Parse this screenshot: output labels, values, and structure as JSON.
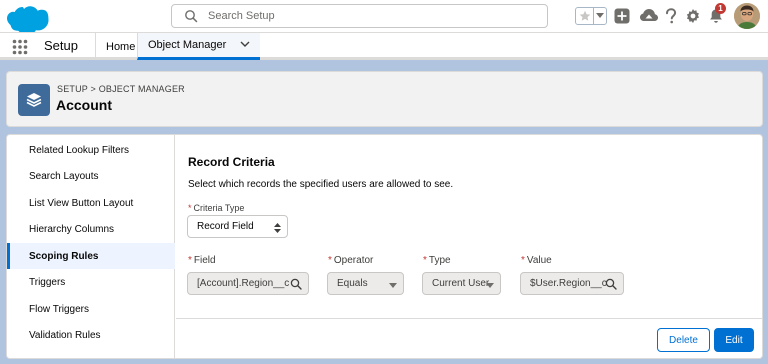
{
  "global_header": {
    "search": {
      "placeholder": "Search Setup",
      "value": ""
    },
    "notification_count": "1",
    "icons": [
      "favorites-star-icon",
      "add-icon",
      "trailhead-icon",
      "help-icon",
      "gear-icon",
      "bell-icon"
    ]
  },
  "context_bar": {
    "app_name": "Setup",
    "tabs": [
      {
        "label": "Home"
      },
      {
        "label": "Object Manager"
      }
    ]
  },
  "page_header": {
    "breadcrumb": "SETUP > OBJECT MANAGER",
    "title": "Account"
  },
  "sidebar": {
    "items": [
      {
        "label": "Related Lookup Filters"
      },
      {
        "label": "Search Layouts"
      },
      {
        "label": "List View Button Layout"
      },
      {
        "label": "Hierarchy Columns"
      },
      {
        "label": "Scoping Rules",
        "active": true
      },
      {
        "label": "Triggers"
      },
      {
        "label": "Flow Triggers"
      },
      {
        "label": "Validation Rules"
      }
    ]
  },
  "record_criteria": {
    "title": "Record Criteria",
    "description": "Select which records the specified users are allowed to see.",
    "criteria_type": {
      "label": "Criteria Type",
      "value": "Record Field"
    },
    "field": {
      "label": "Field",
      "value": "[Account].Region__c"
    },
    "operator": {
      "label": "Operator",
      "value": "Equals"
    },
    "type": {
      "label": "Type",
      "value": "Current User"
    },
    "value": {
      "label": "Value",
      "value": "$User.Region__c"
    }
  },
  "footer": {
    "delete_label": "Delete",
    "edit_label": "Edit"
  },
  "colors": {
    "brand_blue": "#0070d2",
    "page_bg": "#b0c4df",
    "object_icon_bg": "#3f6b9a",
    "badge_red": "#c23934"
  }
}
